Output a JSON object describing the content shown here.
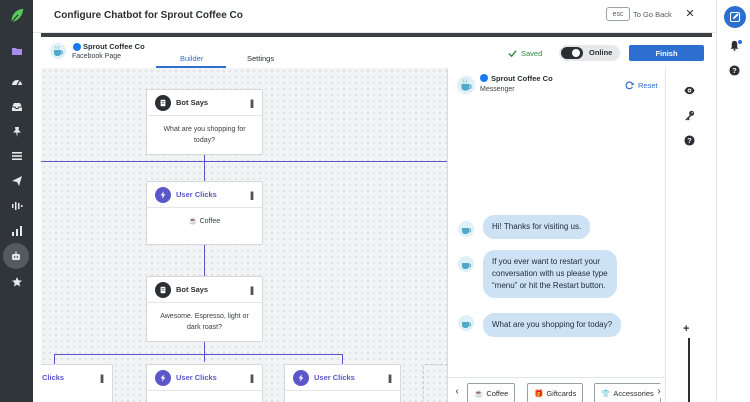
{
  "header": {
    "title": "Configure Chatbot for Sprout Coffee Co",
    "esc_key": "esc",
    "go_back": "To Go Back",
    "close_glyph": "✕"
  },
  "page": {
    "name": "Sprout Coffee Co",
    "type": "Facebook Page"
  },
  "tabs": [
    {
      "label": "Builder",
      "active": true
    },
    {
      "label": "Settings",
      "active": false
    }
  ],
  "status": {
    "saved": "Saved",
    "online_label": "Online",
    "online": true
  },
  "finish_label": "Finish",
  "canvas": {
    "nodes": [
      {
        "kind": "bot",
        "title": "Bot Says",
        "text": "What are you shopping for today?"
      },
      {
        "kind": "user",
        "title": "User Clicks",
        "text": "Coffee",
        "emoji": "☕"
      },
      {
        "kind": "bot",
        "title": "Bot Says",
        "text": "Awesome. Espresso, light or dark roast?"
      },
      {
        "kind": "user",
        "title": "Clicks"
      },
      {
        "kind": "user",
        "title": "User Clicks"
      },
      {
        "kind": "user",
        "title": "User Clicks"
      }
    ],
    "drag_glyph": "||"
  },
  "preview": {
    "name": "Sprout Coffee Co",
    "channel": "Messenger",
    "reset": "Reset",
    "messages": [
      "Hi! Thanks for visiting us.",
      "If you ever want to restart your\nconversation with us please type\n“menu” or hit the Restart button.",
      "What are you shopping for today?"
    ],
    "quick_replies": [
      {
        "emoji": "☕",
        "label": "Coffee"
      },
      {
        "emoji": "🎁",
        "label": "Giftcards"
      },
      {
        "emoji": "👕",
        "label": "Accessories"
      }
    ]
  },
  "tools": {
    "zoom_in": "+"
  },
  "colors": {
    "accent": "#2d6fd1",
    "user_node": "#5b57c9",
    "bubble": "#cde3f5",
    "nav": "#2f3539",
    "saved": "#2e8a3f"
  }
}
